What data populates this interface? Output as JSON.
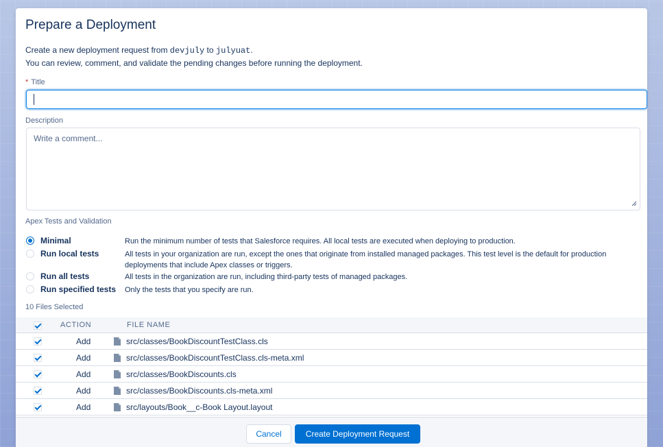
{
  "modal": {
    "title": "Prepare a Deployment",
    "intro_prefix": "Create a new deployment request from ",
    "source_branch": "devjuly",
    "intro_mid": " to ",
    "target_branch": "julyuat",
    "intro_suffix": ".",
    "intro_line2": "You can review, comment, and validate the pending changes before running the deployment."
  },
  "form": {
    "title_label": "Title",
    "title_value": "",
    "description_label": "Description",
    "description_placeholder": "Write a comment..."
  },
  "tests": {
    "heading": "Apex Tests and Validation",
    "selected": "Minimal",
    "options": [
      {
        "label": "Minimal",
        "description": "Run the minimum number of tests that Salesforce requires. All local tests are executed when deploying to production."
      },
      {
        "label": "Run local tests",
        "description": "All tests in your organization are run, except the ones that originate from installed managed packages. This test level is the default for production deployments that include Apex classes or triggers."
      },
      {
        "label": "Run all tests",
        "description": "All tests in the organization are run, including third-party tests of managed packages."
      },
      {
        "label": "Run specified tests",
        "description": "Only the tests that you specify are run."
      }
    ]
  },
  "files": {
    "count_label": "10 Files Selected",
    "columns": [
      "ACTION",
      "FILE NAME"
    ],
    "rows": [
      {
        "action": "Add",
        "file": "src/classes/BookDiscountTestClass.cls"
      },
      {
        "action": "Add",
        "file": "src/classes/BookDiscountTestClass.cls-meta.xml"
      },
      {
        "action": "Add",
        "file": "src/classes/BookDiscounts.cls"
      },
      {
        "action": "Add",
        "file": "src/classes/BookDiscounts.cls-meta.xml"
      },
      {
        "action": "Add",
        "file": "src/layouts/Book__c-Book Layout.layout"
      }
    ]
  },
  "footer": {
    "cancel_label": "Cancel",
    "submit_label": "Create Deployment Request"
  },
  "colors": {
    "brand": "#0070d2",
    "text": "#16325c",
    "weak_text": "#54698d",
    "border": "#d8dde6"
  }
}
